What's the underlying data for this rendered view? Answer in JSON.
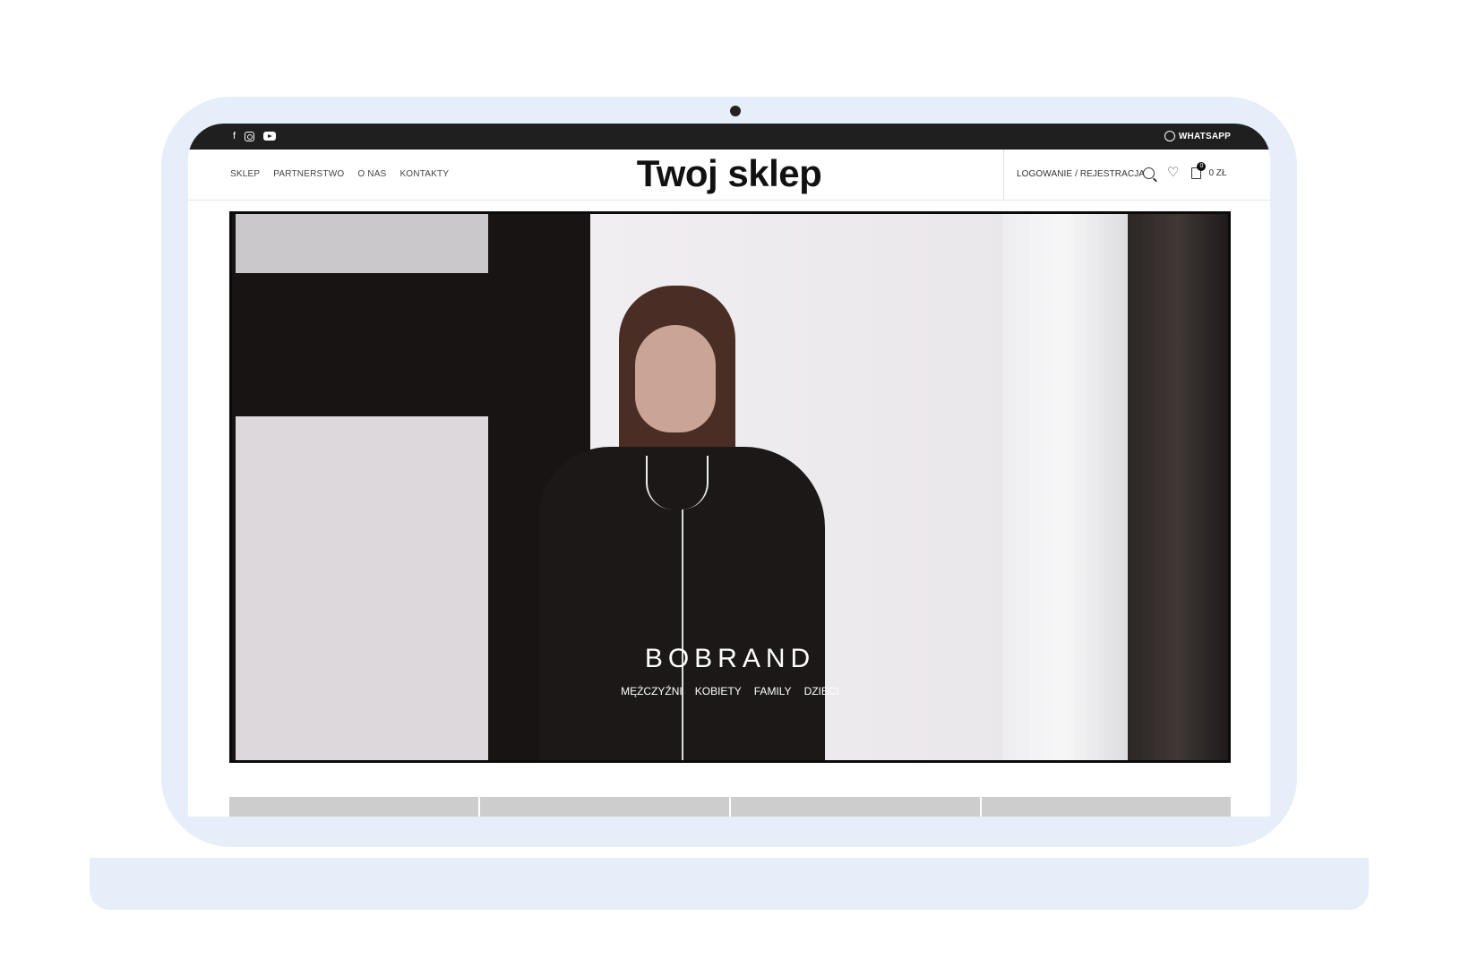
{
  "topbar": {
    "social_icons": [
      "facebook-icon",
      "instagram-icon",
      "youtube-icon"
    ],
    "whatsapp_label": "WHATSAPP"
  },
  "header": {
    "logo": "Twoj sklep",
    "nav": [
      "SKLEP",
      "PARTNERSTWO",
      "O NAS",
      "KONTAKTY"
    ],
    "account_label": "LOGOWANIE / REJESTRACJA",
    "cart_count": "0",
    "cart_total": "0 ZŁ"
  },
  "hero": {
    "brand": "BOBRAND",
    "categories": [
      "MĘŻCZYŹNI",
      "KOBIETY",
      "FAMILY",
      "DZIECI"
    ]
  },
  "colors": {
    "topbar_bg": "#1f1f1f",
    "device_frame": "#e5eef9"
  }
}
